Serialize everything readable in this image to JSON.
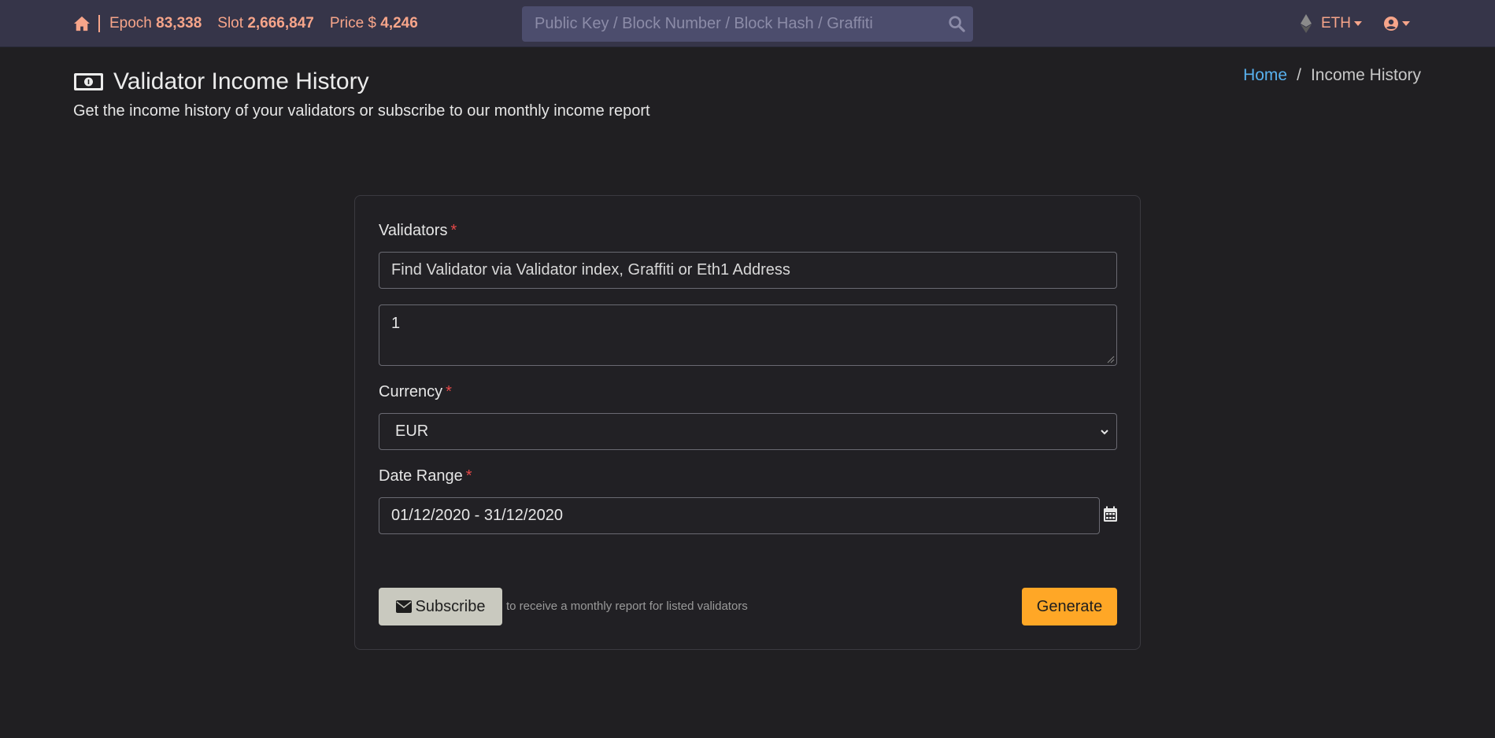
{
  "navbar": {
    "epoch_label": "Epoch",
    "epoch_value": "83,338",
    "slot_label": "Slot",
    "slot_value": "2,666,847",
    "price_label": "Price $",
    "price_value": "4,246",
    "search_placeholder": "Public Key / Block Number / Block Hash / Graffiti",
    "currency_menu": "ETH",
    "home_icon": "home-icon",
    "search_icon": "search-icon",
    "user_icon": "user-circle-icon",
    "accent_color": "#f7a58a"
  },
  "header": {
    "title": "Validator Income History",
    "subtitle": "Get the income history of your validators or subscribe to our monthly income report",
    "title_icon": "money-bill-icon"
  },
  "breadcrumb": {
    "home": "Home",
    "separator": "/",
    "current": "Income History"
  },
  "form": {
    "validators_label": "Validators",
    "required_mark": "*",
    "validator_search_placeholder": "Find Validator via Validator index, Graffiti or Eth1 Address",
    "validators_value": "1",
    "currency_label": "Currency",
    "currency_value": "EUR",
    "date_range_label": "Date Range",
    "date_range_value": "01/12/2020 - 31/12/2020",
    "subscribe_button": "Subscribe",
    "subscribe_note": "to receive a monthly report for listed validators",
    "generate_button": "Generate",
    "generate_color": "#ffa726",
    "required_color": "#e54848"
  }
}
